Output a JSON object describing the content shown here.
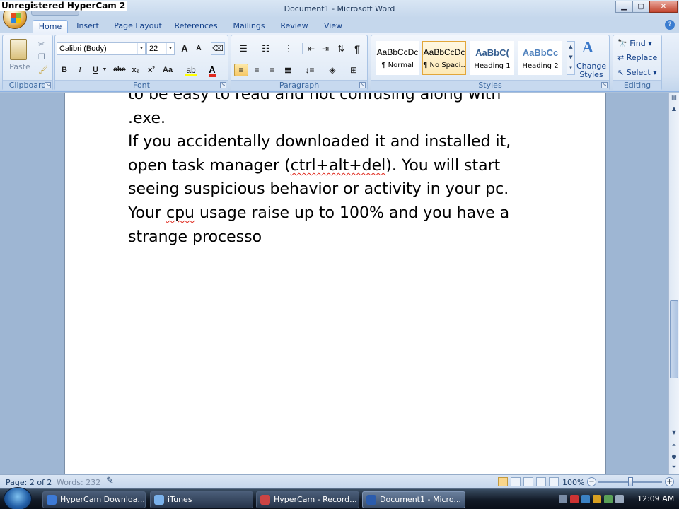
{
  "watermark": "Unregistered HyperCam 2",
  "window": {
    "title": "Document1 - Microsoft Word",
    "minimize": "▁",
    "maximize": "▢",
    "close": "✕"
  },
  "ribbon_tabs": [
    "Home",
    "Insert",
    "Page Layout",
    "References",
    "Mailings",
    "Review",
    "View"
  ],
  "clipboard": {
    "paste": "Paste",
    "label": "Clipboard"
  },
  "font": {
    "name": "Calibri (Body)",
    "size": "22",
    "grow": "A",
    "shrink": "A",
    "bold": "B",
    "italic": "I",
    "underline": "U",
    "strike": "abe",
    "subscript": "x₂",
    "superscript": "x²",
    "case": "Aa",
    "color": "A",
    "label": "Font"
  },
  "paragraph": {
    "label": "Paragraph",
    "pilcrow": "¶"
  },
  "styles": {
    "label": "Styles",
    "items": [
      {
        "sample": "AaBbCcDc",
        "name": "¶ Normal"
      },
      {
        "sample": "AaBbCcDc",
        "name": "¶ No Spaci..."
      },
      {
        "sample": "AaBbC(",
        "name": "Heading 1"
      },
      {
        "sample": "AaBbCc",
        "name": "Heading 2"
      }
    ],
    "change_styles": "Change Styles"
  },
  "editing": {
    "label": "Editing",
    "find": "Find",
    "replace": "Replace",
    "select": "Select"
  },
  "document": {
    "lines": [
      "to be easy to read and not confusing along with",
      ".exe.",
      "If you accidentally downloaded it and installed it,",
      "open task manager (ctrl+alt+del). You will start",
      "seeing suspicious behavior or activity in your pc.",
      "Your cpu usage raise up to 100% and you have a",
      "strange processo"
    ],
    "line4": {
      "before": "open task manager (",
      "squiggle": "ctrl+alt+del",
      "after": "). You will start"
    },
    "line6": {
      "before": "Your ",
      "squiggle": "cpu",
      "after": " usage raise up to 100% and you have a"
    }
  },
  "status": {
    "page": "Page: 2 of 2",
    "words": "Words: 232",
    "zoom": "100%",
    "zoom_minus": "−",
    "zoom_plus": "+"
  },
  "taskbar": {
    "items": [
      {
        "label": "HyperCam Downloa...",
        "icon": "ie-icon",
        "color": "#3d7ad6"
      },
      {
        "label": "iTunes",
        "icon": "itunes-icon",
        "color": "#7ab1ea"
      },
      {
        "label": "HyperCam - Record...",
        "icon": "hypercam-icon",
        "color": "#c44"
      },
      {
        "label": "Document1 - Micro...",
        "icon": "word-icon",
        "color": "#2b5cad"
      }
    ],
    "clock": "12:09 AM"
  },
  "colors": {
    "accent": "#15428b",
    "ribbon": "#dbe7f5",
    "highlight": "#f6c765"
  }
}
